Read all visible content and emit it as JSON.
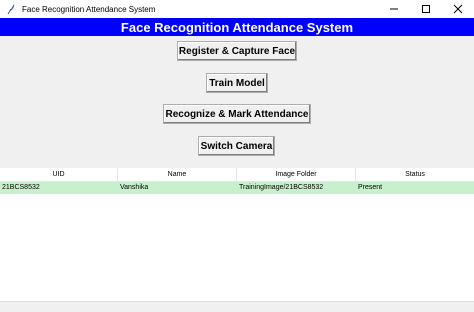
{
  "window": {
    "title": "Face Recognition Attendance System",
    "icon": "feather-icon",
    "controls": [
      "minimize-icon",
      "maximize-icon",
      "close-icon"
    ]
  },
  "banner": {
    "text": "Face Recognition Attendance System",
    "background": "#0000ff",
    "color": "#ffffff"
  },
  "buttons": {
    "register": "Register & Capture Face",
    "train": "Train Model",
    "recognize": "Recognize & Mark Attendance",
    "switch_camera": "Switch Camera"
  },
  "table": {
    "columns": [
      "UID",
      "Name",
      "Image Folder",
      "Status"
    ],
    "rows": [
      {
        "uid": "21BCS8532",
        "name": "Vanshika",
        "folder": "TrainingImage/21BCS8532",
        "status": "Present"
      }
    ],
    "row_highlight": "#c8f0cc"
  }
}
